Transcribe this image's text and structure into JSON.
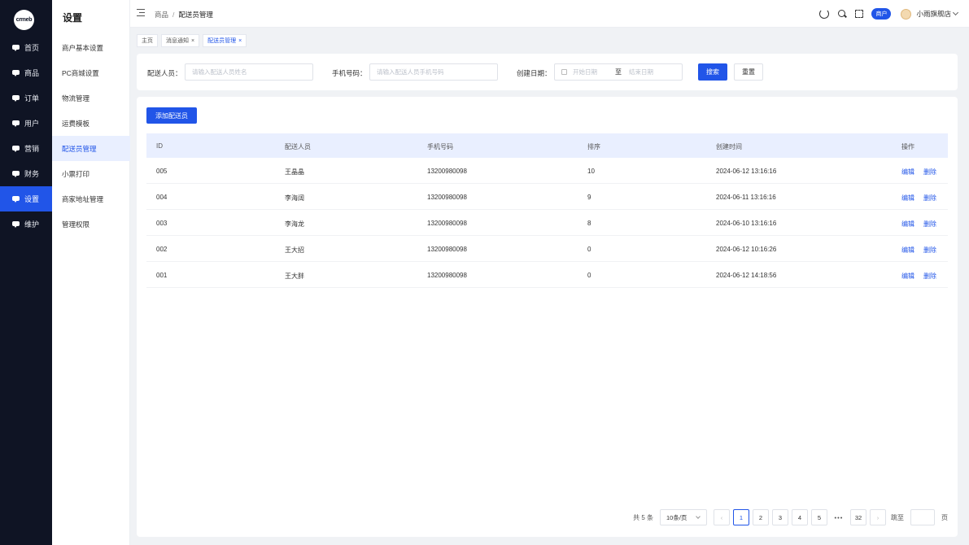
{
  "logo": "crmeb",
  "main_nav": [
    {
      "label": "首页",
      "active": false
    },
    {
      "label": "商品",
      "active": false
    },
    {
      "label": "订单",
      "active": false
    },
    {
      "label": "用户",
      "active": false
    },
    {
      "label": "营销",
      "active": false
    },
    {
      "label": "财务",
      "active": false
    },
    {
      "label": "设置",
      "active": true
    },
    {
      "label": "维护",
      "active": false
    }
  ],
  "sub_nav": {
    "title": "设置",
    "items": [
      {
        "label": "商户基本设置",
        "active": false
      },
      {
        "label": "PC商城设置",
        "active": false
      },
      {
        "label": "物流管理",
        "active": false
      },
      {
        "label": "运费模板",
        "active": false
      },
      {
        "label": "配送员管理",
        "active": true
      },
      {
        "label": "小票打印",
        "active": false
      },
      {
        "label": "商家地址管理",
        "active": false
      },
      {
        "label": "管理权限",
        "active": false
      }
    ]
  },
  "header": {
    "breadcrumb": [
      "商品",
      "配送员管理"
    ],
    "separator": "/",
    "role_badge": "商户",
    "username": "小雨旗舰店"
  },
  "tabs": [
    {
      "label": "主页",
      "closable": false,
      "active": false
    },
    {
      "label": "消息通知",
      "closable": true,
      "active": false
    },
    {
      "label": "配送员管理",
      "closable": true,
      "active": true
    }
  ],
  "filters": {
    "name_label": "配送人员：",
    "name_placeholder": "请输入配送人员姓名",
    "phone_label": "手机号码：",
    "phone_placeholder": "请输入配送人员手机号码",
    "date_label": "创建日期：",
    "date_start_placeholder": "开始日期",
    "date_separator": "至",
    "date_end_placeholder": "结束日期",
    "search_button": "搜索",
    "reset_button": "重置"
  },
  "table": {
    "add_button": "添加配送员",
    "columns": [
      "ID",
      "配送人员",
      "手机号码",
      "排序",
      "创建时间",
      "操作"
    ],
    "rows": [
      {
        "id": "005",
        "name": "王晶晶",
        "phone": "13200980098",
        "sort": "10",
        "created": "2024-06-12 13:16:16"
      },
      {
        "id": "004",
        "name": "李海阔",
        "phone": "13200980098",
        "sort": "9",
        "created": "2024-06-11 13:16:16"
      },
      {
        "id": "003",
        "name": "李海龙",
        "phone": "13200980098",
        "sort": "8",
        "created": "2024-06-10 13:16:16"
      },
      {
        "id": "002",
        "name": "王大招",
        "phone": "13200980098",
        "sort": "0",
        "created": "2024-06-12 10:16:26"
      },
      {
        "id": "001",
        "name": "王大胖",
        "phone": "13200980098",
        "sort": "0",
        "created": "2024-06-12 14:18:56"
      }
    ],
    "edit_label": "编辑",
    "delete_label": "删除"
  },
  "pagination": {
    "total_text": "共 5 条",
    "page_size": "10条/页",
    "prev": "‹",
    "next": "›",
    "pages": [
      "1",
      "2",
      "3",
      "4",
      "5"
    ],
    "ellipsis": "•••",
    "last_page": "32",
    "current_page": "1",
    "jump_label": "跳至",
    "jump_suffix": "页"
  },
  "colors": {
    "primary": "#2155e8",
    "sidebar_bg": "#0f1424",
    "table_header_bg": "#e9efff"
  }
}
